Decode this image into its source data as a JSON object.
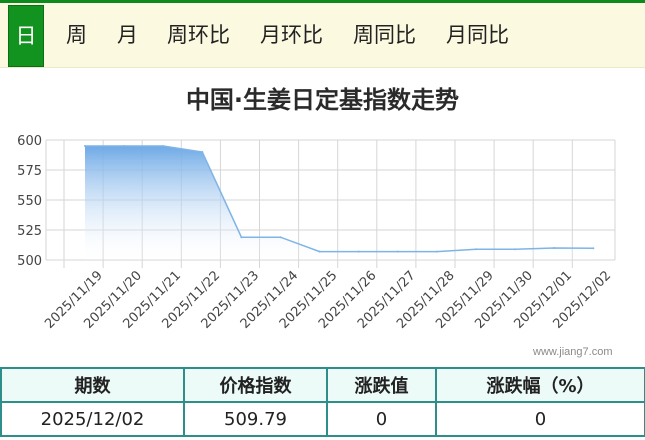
{
  "tabs": [
    {
      "label": "日",
      "active": true
    },
    {
      "label": "周",
      "active": false
    },
    {
      "label": "月",
      "active": false
    },
    {
      "label": "周环比",
      "active": false
    },
    {
      "label": "月环比",
      "active": false
    },
    {
      "label": "周同比",
      "active": false
    },
    {
      "label": "月同比",
      "active": false
    }
  ],
  "watermark": "www.jiang7.com",
  "colors": {
    "accent": "#12921f",
    "series": "#7fb4e6",
    "table_border": "#2e8f8a"
  },
  "chart_data": {
    "type": "area",
    "title": "中国·生姜日定基指数走势",
    "xlabel": "",
    "ylabel": "",
    "ylim": [
      500,
      600
    ],
    "yticks": [
      500,
      525,
      550,
      575,
      600
    ],
    "grid": true,
    "categories": [
      "2025/11/19",
      "2025/11/20",
      "2025/11/21",
      "2025/11/22",
      "2025/11/23",
      "2025/11/24",
      "2025/11/25",
      "2025/11/26",
      "2025/11/27",
      "2025/11/28",
      "2025/11/29",
      "2025/11/30",
      "2025/12/01",
      "2025/12/02"
    ],
    "series": [
      {
        "values": [
          595,
          595,
          595,
          590,
          519,
          519,
          507,
          507,
          507,
          507,
          509,
          509,
          510,
          509.79
        ]
      }
    ]
  },
  "table": {
    "headers": [
      "期数",
      "价格指数",
      "涨跌值",
      "涨跌幅（%）"
    ],
    "row": [
      "2025/12/02",
      "509.79",
      "0",
      "0"
    ]
  }
}
